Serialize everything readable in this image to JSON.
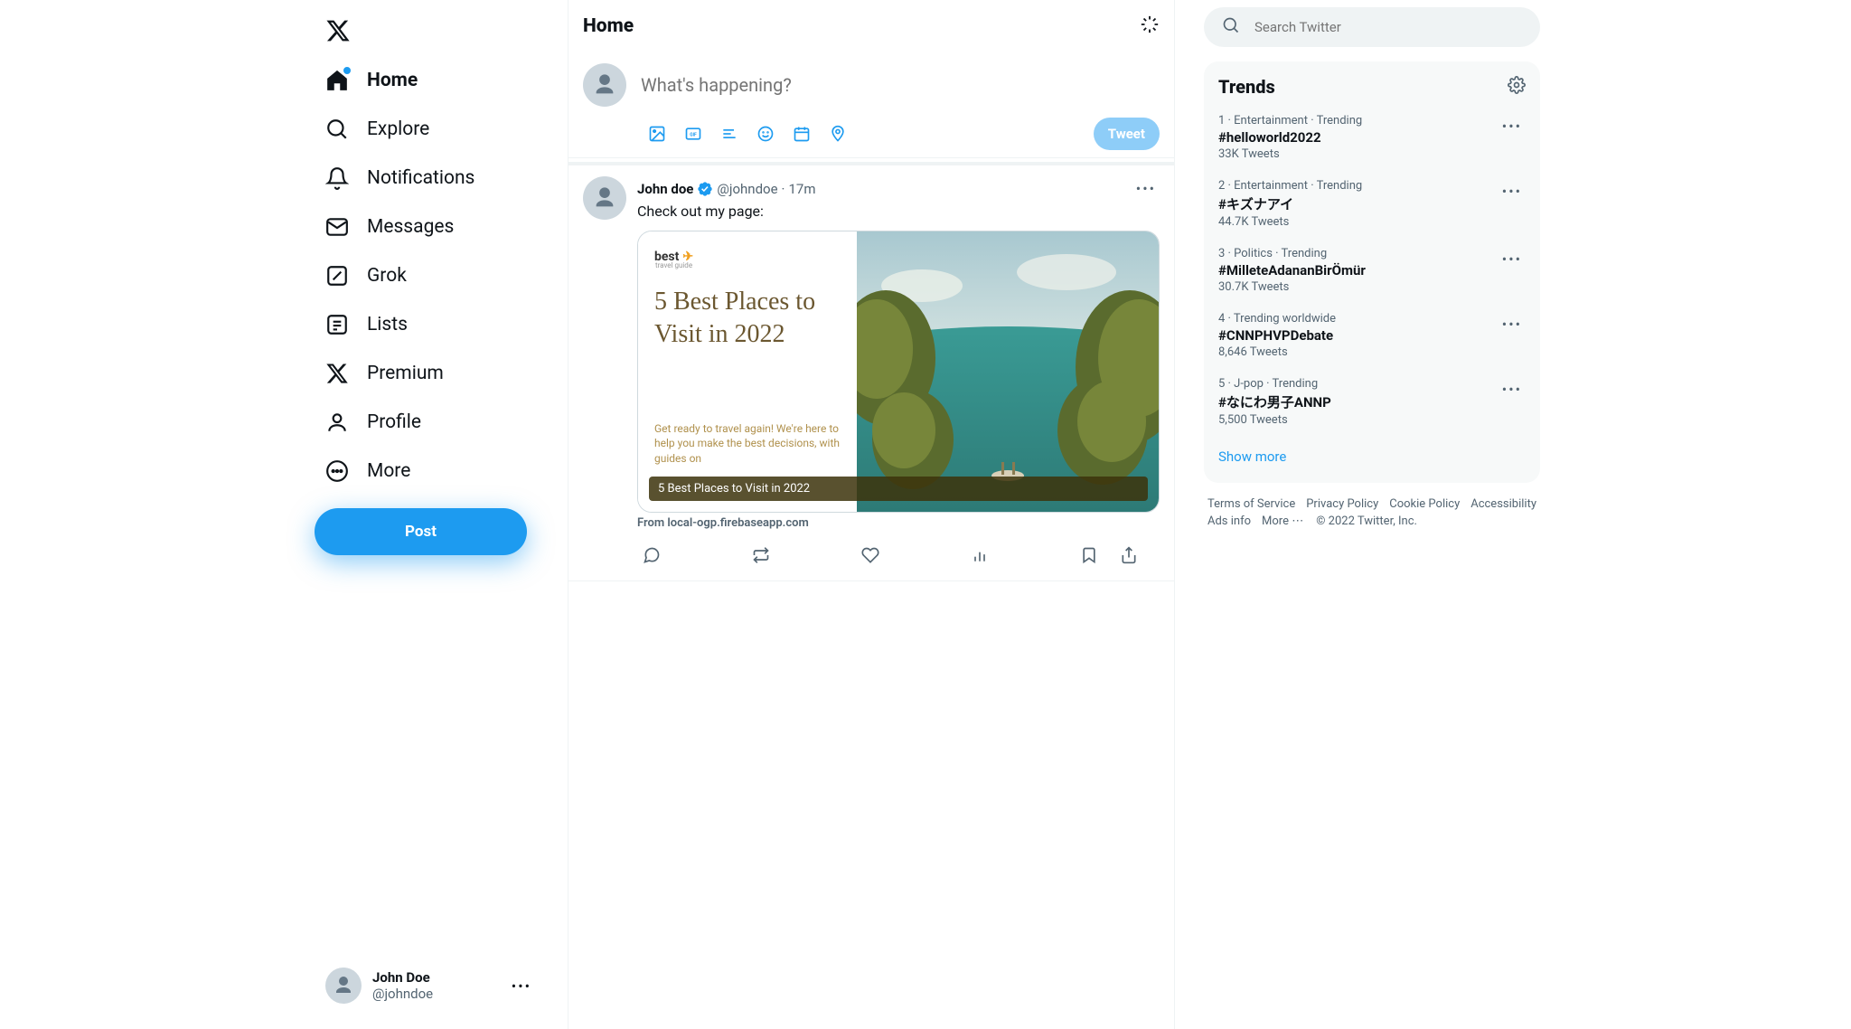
{
  "header": {
    "title": "Home"
  },
  "nav": {
    "items": [
      {
        "label": "Home"
      },
      {
        "label": "Explore"
      },
      {
        "label": "Notifications"
      },
      {
        "label": "Messages"
      },
      {
        "label": "Grok"
      },
      {
        "label": "Lists"
      },
      {
        "label": "Premium"
      },
      {
        "label": "Profile"
      },
      {
        "label": "More"
      }
    ],
    "post_label": "Post"
  },
  "current_user": {
    "name": "John Doe",
    "handle": "@johndoe"
  },
  "compose": {
    "placeholder": "What's happening?",
    "button_label": "Tweet"
  },
  "tweet": {
    "author_name": "John doe",
    "author_handle": "@johndoe",
    "time": "17m",
    "body_text": "Check out my page:",
    "card": {
      "logo_main": "best",
      "logo_sub": "travel guide",
      "title": "5 Best Places to Visit in 2022",
      "subtitle": "Get ready to travel again! We're here to help you make the best decisions, with guides on",
      "band": "5 Best Places to Visit in 2022",
      "source": "From local-ogp.firebaseapp.com"
    }
  },
  "search": {
    "placeholder": "Search Twitter"
  },
  "trends": {
    "title": "Trends",
    "show_more": "Show more",
    "items": [
      {
        "meta": "1 · Entertainment · Trending",
        "name": "#helloworld2022",
        "count": "33K Tweets"
      },
      {
        "meta": "2 · Entertainment · Trending",
        "name": "#キズナアイ",
        "count": "44.7K Tweets"
      },
      {
        "meta": "3 · Politics · Trending",
        "name": "#MilleteAdananBirÖmür",
        "count": "30.7K Tweets"
      },
      {
        "meta": "4 · Trending worldwide",
        "name": "#CNNPHVPDebate",
        "count": "8,646 Tweets"
      },
      {
        "meta": "5 · J-pop · Trending",
        "name": "#なにわ男子ANNP",
        "count": "5,500 Tweets"
      }
    ]
  },
  "footer": {
    "links": [
      "Terms of Service",
      "Privacy Policy",
      "Cookie Policy",
      "Accessibility",
      "Ads info"
    ],
    "more": "More",
    "copyright": "© 2022 Twitter, Inc."
  }
}
